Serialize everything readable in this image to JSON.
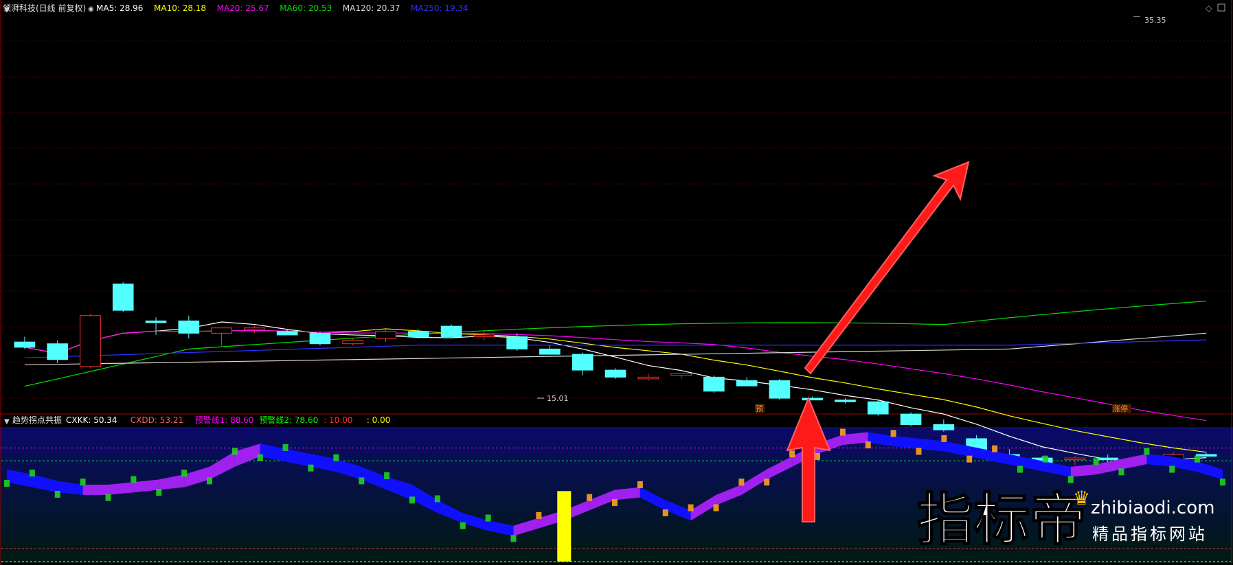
{
  "main_panel": {
    "title": "领湃科技(日线 前复权)",
    "ma_legend": [
      {
        "label": "MA5: 28.96",
        "color": "#ffffff"
      },
      {
        "label": "MA10: 28.18",
        "color": "#ffff00"
      },
      {
        "label": "MA20: 25.67",
        "color": "#ff00ff"
      },
      {
        "label": "MA60: 20.53",
        "color": "#00e000"
      },
      {
        "label": "MA120: 20.37",
        "color": "#d8d8d8"
      },
      {
        "label": "MA250: 19.34",
        "color": "#3030ff"
      }
    ],
    "high_label": "35.35",
    "low_label": "15.01",
    "tag_pre": "预",
    "tag_limit": "涨停"
  },
  "sub_panel": {
    "title": "趋势拐点共振",
    "legend": [
      {
        "label": "CXKK: 50.34",
        "color": "#ffffff"
      },
      {
        "label": "CXDD: 53.21",
        "color": "#ff6060"
      },
      {
        "label": "预警线1: 88.60",
        "color": "#ff00ff"
      },
      {
        "label": "预警线2: 78.60",
        "color": "#00ff00"
      },
      {
        "label": ": 10.00",
        "color": "#ff3030"
      },
      {
        "label": ": 0.00",
        "color": "#ffff00"
      }
    ]
  },
  "watermark": {
    "logo_text": "指标帝",
    "domain": "zhibiaodi.com",
    "slogan": "精品指标网站"
  },
  "chart_data": [
    {
      "type": "candlestick",
      "title": "领湃科技(日线 前复权)",
      "ylim": [
        14.0,
        36.5
      ],
      "up_color": "#ff3030",
      "down_color": "#54ffff",
      "candles": [
        {
          "o": 17.9,
          "h": 18.2,
          "l": 17.5,
          "c": 17.6
        },
        {
          "o": 17.8,
          "h": 18.0,
          "l": 16.7,
          "c": 16.9
        },
        {
          "o": 16.5,
          "h": 19.5,
          "l": 16.4,
          "c": 19.4
        },
        {
          "o": 21.2,
          "h": 21.3,
          "l": 19.6,
          "c": 19.7
        },
        {
          "o": 19.1,
          "h": 19.3,
          "l": 18.3,
          "c": 19.0
        },
        {
          "o": 19.1,
          "h": 19.4,
          "l": 18.1,
          "c": 18.4
        },
        {
          "o": 18.4,
          "h": 18.6,
          "l": 17.7,
          "c": 18.7
        },
        {
          "o": 18.6,
          "h": 18.8,
          "l": 18.4,
          "c": 18.7
        },
        {
          "o": 18.5,
          "h": 18.6,
          "l": 18.3,
          "c": 18.3
        },
        {
          "o": 18.4,
          "h": 18.5,
          "l": 17.7,
          "c": 17.8
        },
        {
          "o": 17.8,
          "h": 18.1,
          "l": 17.7,
          "c": 18.0
        },
        {
          "o": 18.1,
          "h": 18.6,
          "l": 17.9,
          "c": 18.5
        },
        {
          "o": 18.5,
          "h": 18.6,
          "l": 18.1,
          "c": 18.2
        },
        {
          "o": 18.8,
          "h": 18.9,
          "l": 18.1,
          "c": 18.2
        },
        {
          "o": 18.2,
          "h": 18.6,
          "l": 18.0,
          "c": 18.3
        },
        {
          "o": 18.2,
          "h": 18.4,
          "l": 17.4,
          "c": 17.5
        },
        {
          "o": 17.5,
          "h": 17.7,
          "l": 17.2,
          "c": 17.2
        },
        {
          "o": 17.2,
          "h": 17.3,
          "l": 16.0,
          "c": 16.3
        },
        {
          "o": 16.3,
          "h": 16.4,
          "l": 15.8,
          "c": 15.9
        },
        {
          "o": 15.8,
          "h": 16.1,
          "l": 15.7,
          "c": 15.9
        },
        {
          "o": 16.0,
          "h": 16.1,
          "l": 15.8,
          "c": 16.1
        },
        {
          "o": 15.9,
          "h": 16.0,
          "l": 15.0,
          "c": 15.1
        },
        {
          "o": 15.7,
          "h": 15.9,
          "l": 15.4,
          "c": 15.4
        },
        {
          "o": 15.7,
          "h": 15.8,
          "l": 14.6,
          "c": 14.7
        },
        {
          "o": 14.7,
          "h": 14.8,
          "l": 14.6,
          "c": 14.6
        },
        {
          "o": 14.6,
          "h": 14.7,
          "l": 14.4,
          "c": 14.5
        },
        {
          "o": 14.5,
          "h": 14.6,
          "l": 13.7,
          "c": 13.8
        },
        {
          "o": 13.8,
          "h": 13.9,
          "l": 13.1,
          "c": 13.2
        },
        {
          "o": 13.2,
          "h": 13.5,
          "l": 12.8,
          "c": 12.9
        },
        {
          "o": 12.4,
          "h": 12.6,
          "l": 11.6,
          "c": 11.7
        },
        {
          "o": 11.5,
          "h": 11.8,
          "l": 11.0,
          "c": 11.1
        },
        {
          "o": 11.3,
          "h": 11.4,
          "l": 10.8,
          "c": 10.8
        },
        {
          "o": 11.2,
          "h": 11.4,
          "l": 10.9,
          "c": 11.3
        },
        {
          "o": 11.3,
          "h": 11.5,
          "l": 10.8,
          "c": 11.2
        },
        {
          "o": 11.3,
          "h": 11.4,
          "l": 11.0,
          "c": 11.2
        },
        {
          "o": 11.2,
          "h": 11.6,
          "l": 11.1,
          "c": 11.5
        },
        {
          "o": 11.5,
          "h": 11.6,
          "l": 11.4,
          "c": 11.4
        }
      ],
      "moving_averages": [
        {
          "name": "MA5",
          "color": "#ffffff"
        },
        {
          "name": "MA10",
          "color": "#ffff00"
        },
        {
          "name": "MA20",
          "color": "#ff00ff"
        },
        {
          "name": "MA60",
          "color": "#00e000"
        },
        {
          "name": "MA120",
          "color": "#d8d8d8"
        },
        {
          "name": "MA250",
          "color": "#3030ff"
        }
      ]
    },
    {
      "type": "area",
      "title": "趋势拐点共振",
      "ylim": [
        0,
        105
      ],
      "reference_lines": [
        88.6,
        78.6,
        10.0,
        0.0
      ],
      "band_upper": [
        72,
        68,
        63,
        60,
        60,
        62,
        64,
        68,
        74,
        86,
        92,
        88,
        84,
        80,
        74,
        66,
        60,
        48,
        38,
        32,
        28,
        34,
        40,
        48,
        56,
        58,
        48,
        40,
        52,
        60,
        72,
        82,
        92,
        99,
        101,
        98,
        96,
        94,
        90,
        86,
        82,
        78,
        74,
        76,
        80,
        84,
        82,
        78,
        72
      ],
      "band_lower": [
        62,
        58,
        54,
        52,
        52,
        54,
        56,
        58,
        64,
        74,
        82,
        78,
        74,
        70,
        64,
        56,
        48,
        38,
        30,
        24,
        20,
        26,
        32,
        40,
        48,
        50,
        40,
        32,
        44,
        52,
        64,
        74,
        84,
        91,
        93,
        90,
        88,
        86,
        82,
        78,
        74,
        70,
        66,
        68,
        72,
        76,
        74,
        70,
        64
      ],
      "signal_bar_index": 22
    }
  ]
}
